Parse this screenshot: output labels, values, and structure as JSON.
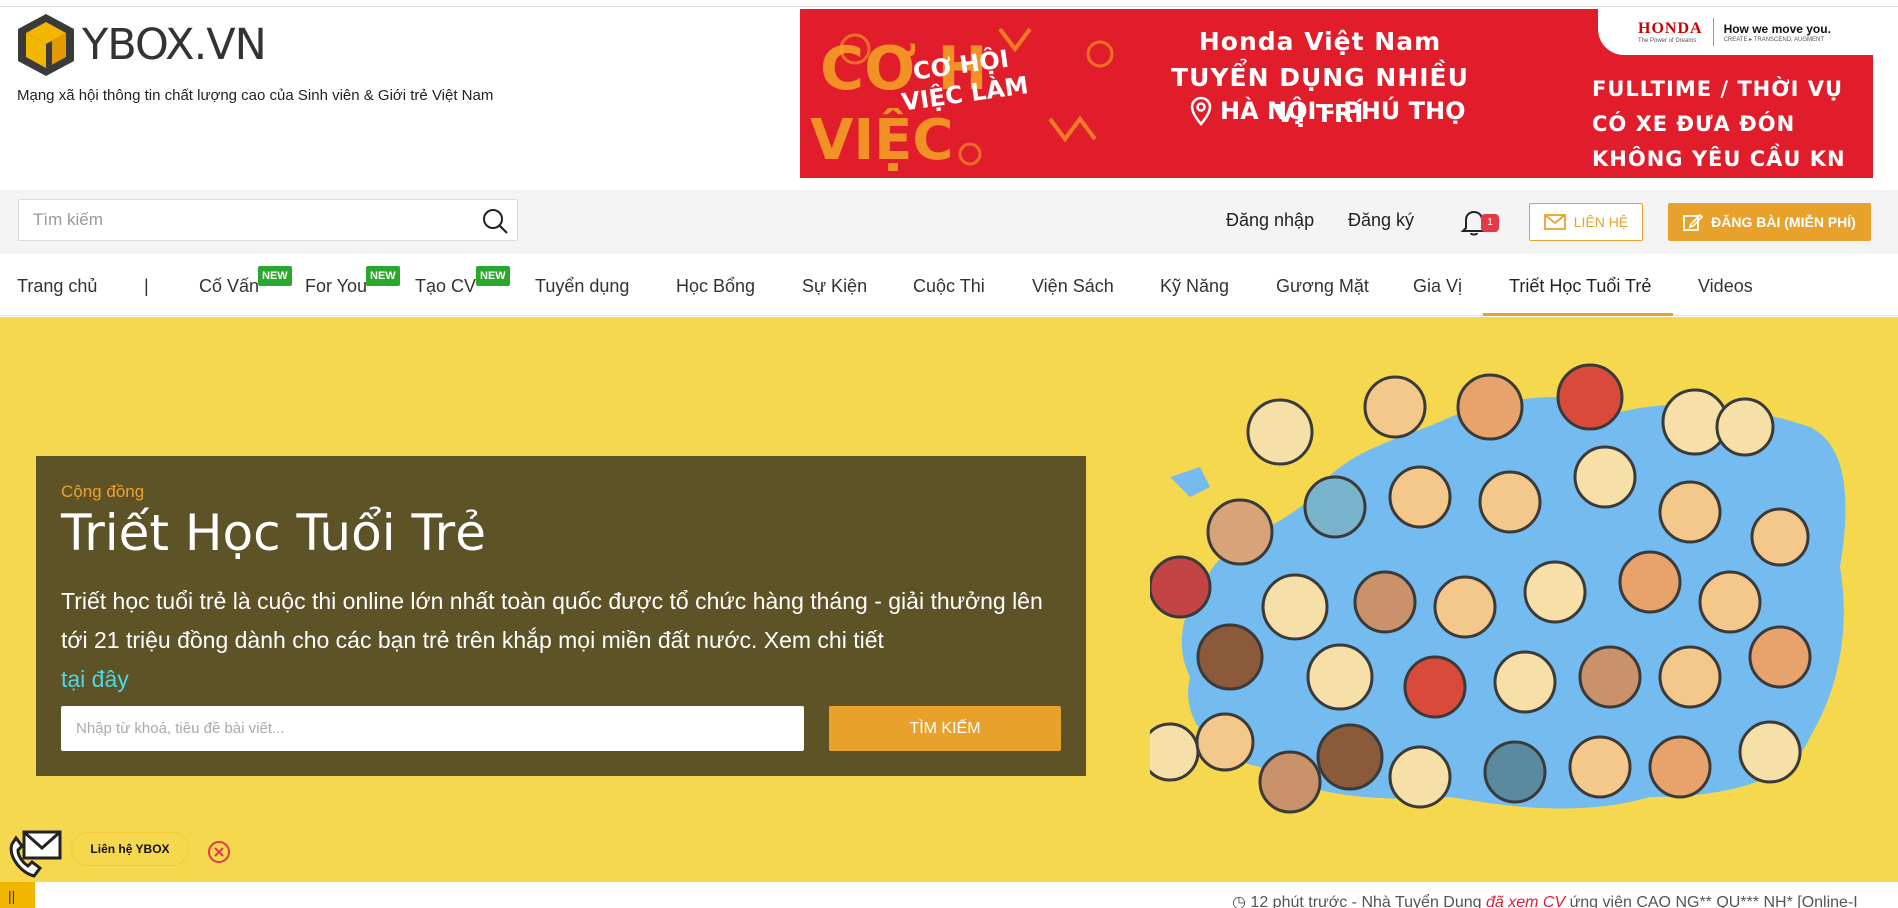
{
  "header": {
    "logo_text": "YBOX.VN",
    "tagline": "Mạng xã hội thông tin chất lượng cao của Sinh viên & Giới trẻ Việt Nam"
  },
  "banner": {
    "left_text": "CƠ HỘI VIỆC LÀM",
    "title_line1": "Honda Việt Nam",
    "title_line2": "TUYỂN DỤNG NHIỀU VỊ TRÍ",
    "location": "HÀ NỘI - PHÚ THỌ",
    "right_line1": "FULLTIME / THỜI VỤ",
    "right_line2": "CÓ XE ĐƯA ĐÓN",
    "right_line3": "KHÔNG YÊU CẦU KN",
    "brand": "HONDA",
    "brand_sub": "The Power of Dreams",
    "brand_slogan": "How we move you.",
    "brand_slogan_sub": "CREATE ▸ TRANSCEND, AUGMENT"
  },
  "toolbar": {
    "search_placeholder": "Tìm kiếm",
    "login": "Đăng nhập",
    "register": "Đăng ký",
    "notification_count": "1",
    "contact_button": "LIÊN HỆ",
    "post_button": "ĐĂNG BÀI (MIỄN PHÍ)"
  },
  "nav": {
    "home": "Trang chủ",
    "separator": "|",
    "items": [
      "Cố Vấn",
      "For You",
      "Tạo CV",
      "Tuyển dụng",
      "Học Bổng",
      "Sự Kiện",
      "Cuộc Thi",
      "Viện Sách",
      "Kỹ Năng",
      "Gương Mặt",
      "Gia Vị",
      "Triết Học Tuổi Trẻ",
      "Videos"
    ],
    "new_badge": "NEW"
  },
  "hero": {
    "category": "Cộng đồng",
    "title": "Triết Học Tuổi Trẻ",
    "description": "Triết học tuổi trẻ là cuộc thi online lớn nhất toàn quốc được tổ chức hàng tháng - giải thưởng lên tới 21 triệu đồng dành cho các bạn trẻ trên khắp mọi miền đất nước. Xem chi tiết",
    "link_text": "tại đây",
    "input_placeholder": "Nhập từ khoá, tiêu đề bài viết...",
    "search_button": "TÌM KIẾM"
  },
  "floating": {
    "contact_label": "Liên hệ YBOX"
  },
  "ticker": {
    "handle": "||",
    "time": "12 phút trước",
    "prefix": " - Nhà Tuyển Dụng ",
    "action": "đã xem CV",
    "suffix": " ứng viên CAO NG** QU*** NH* [Online-I"
  },
  "colors": {
    "accent": "#e8a22c",
    "hero_bg": "#f6d84e",
    "card_bg": "#5d5326",
    "banner_red": "#e11d2b",
    "new_green": "#2aa82e"
  }
}
